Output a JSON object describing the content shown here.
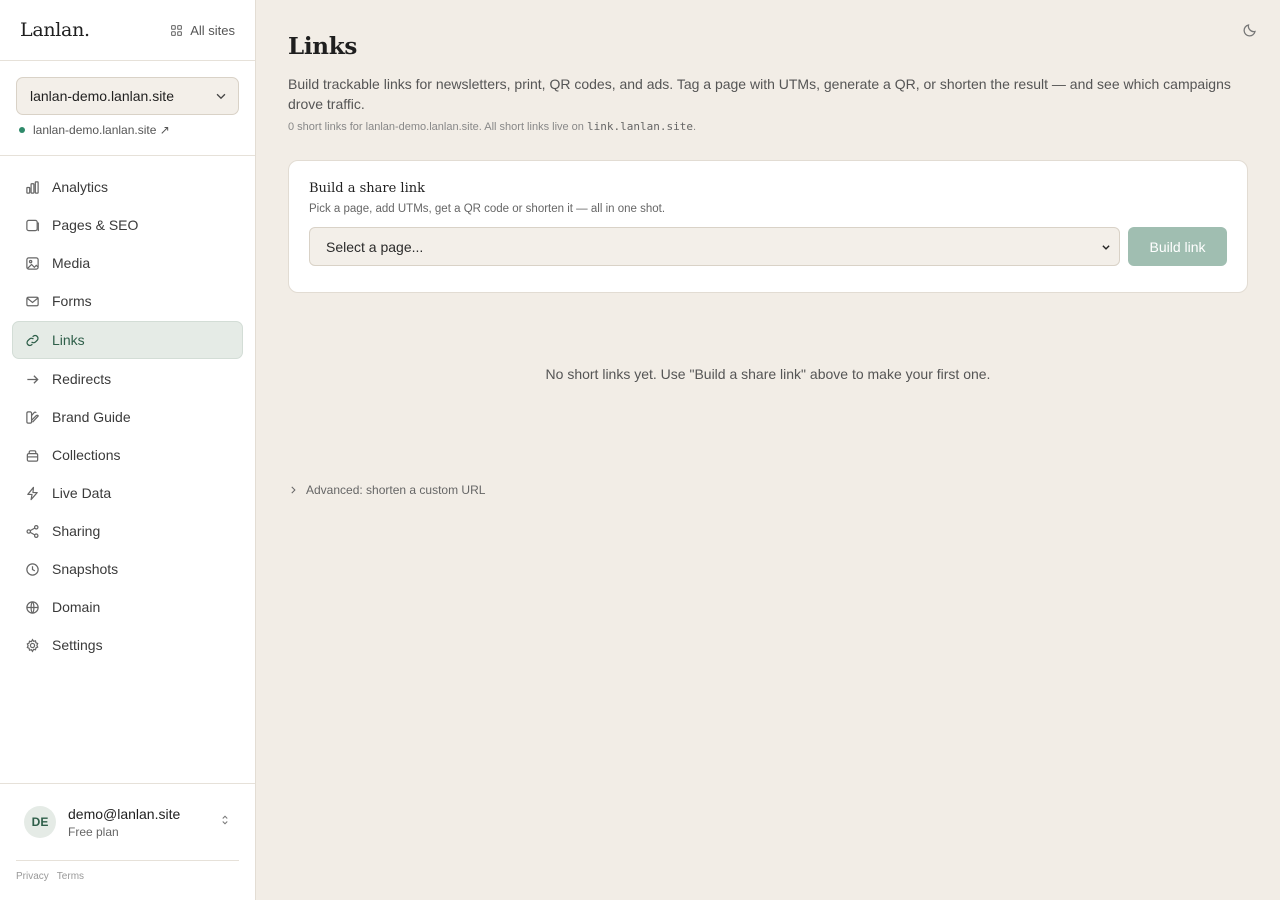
{
  "brand": {
    "logo": "Lanlan.",
    "all_sites": "All sites"
  },
  "site": {
    "selected": "lanlan-demo.lanlan.site",
    "link": "lanlan-demo.lanlan.site ↗"
  },
  "nav": {
    "items": [
      {
        "label": "Analytics",
        "icon": "bar-chart-icon"
      },
      {
        "label": "Pages & SEO",
        "icon": "page-icon"
      },
      {
        "label": "Media",
        "icon": "image-icon"
      },
      {
        "label": "Forms",
        "icon": "mail-icon"
      },
      {
        "label": "Links",
        "icon": "link-icon",
        "active": true
      },
      {
        "label": "Redirects",
        "icon": "arrow-right-icon"
      },
      {
        "label": "Brand Guide",
        "icon": "palette-icon"
      },
      {
        "label": "Collections",
        "icon": "collection-icon"
      },
      {
        "label": "Live Data",
        "icon": "lightning-icon"
      },
      {
        "label": "Sharing",
        "icon": "share-icon"
      },
      {
        "label": "Snapshots",
        "icon": "clock-icon"
      },
      {
        "label": "Domain",
        "icon": "globe-icon"
      },
      {
        "label": "Settings",
        "icon": "gear-icon"
      }
    ]
  },
  "account": {
    "initials": "DE",
    "email": "demo@lanlan.site",
    "plan": "Free plan",
    "privacy": "Privacy",
    "terms": "Terms"
  },
  "main": {
    "title": "Links",
    "description": "Build trackable links for newsletters, print, QR codes, and ads. Tag a page with UTMs, generate a QR, or shorten the result — and see which campaigns drove traffic.",
    "meta_prefix": "0 short links for lanlan-demo.lanlan.site. All short links live on ",
    "meta_domain": "link.lanlan.site",
    "meta_suffix": "."
  },
  "card": {
    "title": "Build a share link",
    "subtitle": "Pick a page, add UTMs, get a QR code or shorten it — all in one shot.",
    "select_placeholder": "Select a page...",
    "button": "Build link"
  },
  "empty_state": "No short links yet. Use \"Build a share link\" above to make your first one.",
  "advanced": "Advanced: shorten a custom URL",
  "colors": {
    "accent": "#2f5f4a",
    "button": "#a0beb1",
    "background": "#f2ede6"
  }
}
